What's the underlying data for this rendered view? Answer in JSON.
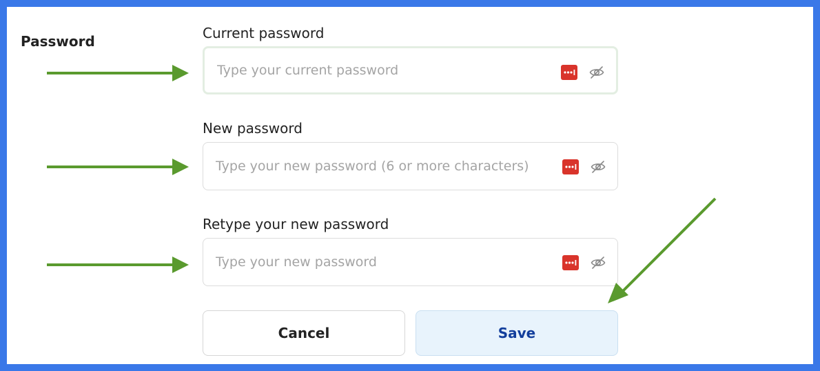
{
  "section": {
    "title": "Password"
  },
  "fields": [
    {
      "label": "Current password",
      "placeholder": "Type your current password",
      "value": ""
    },
    {
      "label": "New password",
      "placeholder": "Type your new password (6 or more characters)",
      "value": ""
    },
    {
      "label": "Retype your new password",
      "placeholder": "Type your new password",
      "value": ""
    }
  ],
  "buttons": {
    "cancel": "Cancel",
    "save": "Save"
  },
  "icons": {
    "password_manager": "password-manager-icon",
    "toggle_visibility": "eye-slash-icon"
  },
  "colors": {
    "frame": "#3a78e8",
    "annotation_arrow": "#5a9a2e",
    "password_manager": "#d9342b",
    "save_bg": "#e8f3fc",
    "save_text": "#123e9c"
  }
}
